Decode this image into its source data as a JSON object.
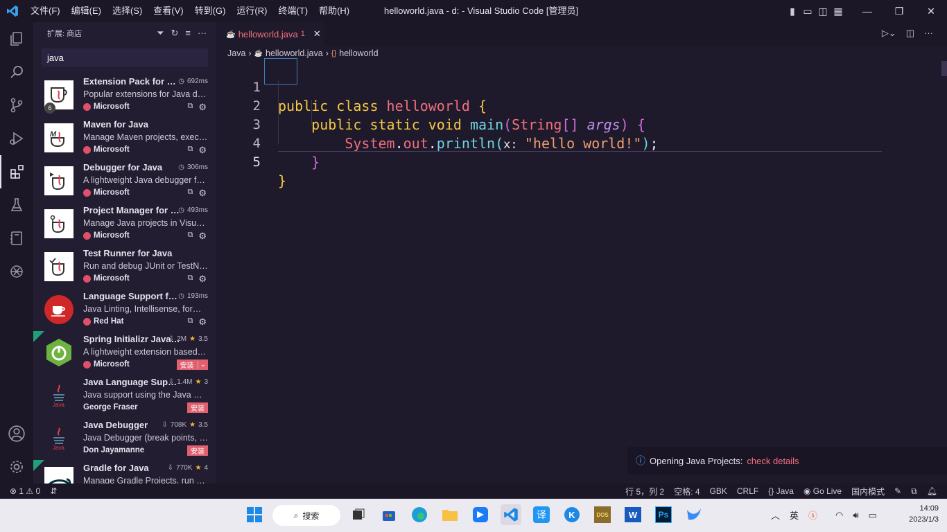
{
  "titlebar": {
    "menus": [
      "文件(F)",
      "编辑(E)",
      "选择(S)",
      "查看(V)",
      "转到(G)",
      "运行(R)",
      "终端(T)",
      "帮助(H)"
    ],
    "title": "helloworld.java - d: - Visual Studio Code [管理员]"
  },
  "sidebar": {
    "header": "扩展: 商店",
    "search_value": "java",
    "extensions": [
      {
        "name": "Extension Pack for Java",
        "meta": "692ms",
        "desc": "Popular extensions for Java development",
        "publisher": "Microsoft",
        "badge": "6"
      },
      {
        "name": "Maven for Java",
        "meta": "",
        "desc": "Manage Maven projects, execute goals",
        "publisher": "Microsoft"
      },
      {
        "name": "Debugger for Java",
        "meta": "306ms",
        "desc": "A lightweight Java debugger for VS Code",
        "publisher": "Microsoft"
      },
      {
        "name": "Project Manager for Java",
        "meta": "493ms",
        "desc": "Manage Java projects in Visual Studio Code",
        "publisher": "Microsoft"
      },
      {
        "name": "Test Runner for Java",
        "meta": "",
        "desc": "Run and debug JUnit or TestNG test cases",
        "publisher": "Microsoft"
      },
      {
        "name": "Language Support for Java",
        "meta": "193ms",
        "desc": "Java Linting, Intellisense, formatting",
        "publisher": "Red Hat"
      },
      {
        "name": "Spring Initializr Java Support",
        "meta": "2M",
        "rating": "3.5",
        "desc": "A lightweight extension based on Spring Initializr",
        "publisher": "Microsoft",
        "install": "安装"
      },
      {
        "name": "Java Language Support",
        "meta": "1.4M",
        "rating": "3",
        "desc": "Java support using the Java Compiler API",
        "publisher": "George Fraser",
        "install": "安装"
      },
      {
        "name": "Java Debugger",
        "meta": "708K",
        "rating": "3.5",
        "desc": "Java Debugger (break points, variables)",
        "publisher": "Don Jayamanne",
        "install": "安装"
      },
      {
        "name": "Gradle for Java",
        "meta": "770K",
        "rating": "4",
        "desc": "Manage Gradle Projects, run Gradle tasks",
        "publisher": ""
      }
    ]
  },
  "editor": {
    "tab_label": "helloworld.java",
    "tab_problems": "1",
    "breadcrumb": [
      "Java",
      "helloworld.java",
      "helloworld"
    ],
    "line_numbers": [
      "1",
      "2",
      "3",
      "4",
      "5"
    ]
  },
  "notification": {
    "text": "Opening Java Projects:",
    "link": "check details"
  },
  "statusbar": {
    "errors": "1",
    "warnings": "0",
    "position": "行 5，列 2",
    "indent": "空格: 4",
    "encoding": "GBK",
    "eol": "CRLF",
    "language": "Java",
    "golive": "Go Live",
    "mode": "国内模式"
  },
  "taskbar": {
    "search": "搜索",
    "time": "14:09",
    "date": "2023/1/3"
  },
  "colors": {
    "accent": "#ef6f7e",
    "keyword": "#f5c842",
    "function": "#6dd4e0"
  }
}
